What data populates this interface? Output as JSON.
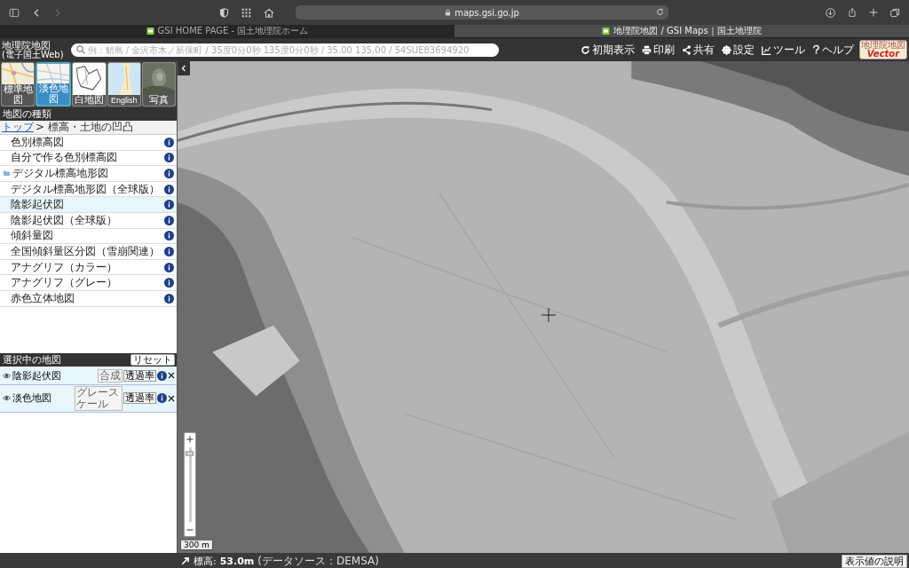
{
  "browser": {
    "url": "maps.gsi.go.jp",
    "tabs": [
      {
        "title": "GSI HOME PAGE - 国土地理院ホーム",
        "selected": false
      },
      {
        "title": "地理院地図 / GSI Maps｜国土地理院",
        "selected": true
      }
    ]
  },
  "header": {
    "logo_title": "地理院地図",
    "logo_subtitle": "(電子国土Web)",
    "search": {
      "placeholder": "例：鯖島 / 金沢市木ノ新保町 / 35度0分0秒 135度0分0秒 / 35.00 135.00 / 54SUE83694920"
    },
    "tools": [
      {
        "kind": "reset",
        "label": "初期表示"
      },
      {
        "kind": "print",
        "label": "印刷"
      },
      {
        "kind": "share",
        "label": "共有"
      },
      {
        "kind": "settings",
        "label": "設定"
      },
      {
        "kind": "tool",
        "label": "ツール"
      },
      {
        "kind": "help",
        "label": "ヘルプ"
      }
    ],
    "badge": {
      "top": "地理院地図",
      "bottom": "Vector"
    }
  },
  "basemaps": [
    {
      "label": "標準地図",
      "kind": "standard",
      "selected": false
    },
    {
      "label": "淡色地図",
      "kind": "pale",
      "selected": true
    },
    {
      "label": "白地図",
      "kind": "blank",
      "selected": false
    },
    {
      "label": "English",
      "kind": "english",
      "selected": false
    },
    {
      "label": "写真",
      "selected": false
    }
  ],
  "map_types": {
    "title": "地図の種類",
    "breadcrumb_link": "トップ",
    "breadcrumb_current": "> 標高・土地の凹凸",
    "items": [
      {
        "label": "色別標高図",
        "kind": "item",
        "selected": false
      },
      {
        "label": "自分で作る色別標高図",
        "kind": "item",
        "selected": false
      },
      {
        "label": "デジタル標高地形図",
        "kind": "folder",
        "selected": false
      },
      {
        "label": "デジタル標高地形図（全球版）",
        "kind": "item",
        "selected": false
      },
      {
        "label": "陰影起伏図",
        "kind": "item",
        "selected": true
      },
      {
        "label": "陰影起伏図（全球版）",
        "kind": "item",
        "selected": false
      },
      {
        "label": "傾斜量図",
        "kind": "item",
        "selected": false
      },
      {
        "label": "全国傾斜量区分図（雪崩関連）",
        "kind": "item",
        "selected": false
      },
      {
        "label": "アナグリフ（カラー）",
        "kind": "item",
        "selected": false
      },
      {
        "label": "アナグリフ（グレー）",
        "kind": "item",
        "selected": false
      },
      {
        "label": "赤色立体地図",
        "kind": "item",
        "selected": false
      }
    ]
  },
  "selected_maps": {
    "title": "選択中の地図",
    "reset_label": "リセット",
    "layers": [
      {
        "name": "陰影起伏図",
        "visible": true,
        "option": "合成",
        "opacity_label": "透過率"
      },
      {
        "name": "淡色地図",
        "visible": true,
        "option": "グレースケール",
        "opacity_label": "透過率"
      }
    ]
  },
  "map": {
    "zoom": {
      "level": 0.92
    },
    "scale": "300 m"
  },
  "status_bar": {
    "label": "標高:",
    "value": "53.0m",
    "source": "(データソース：DEMSA)",
    "button": "表示値の説明"
  }
}
